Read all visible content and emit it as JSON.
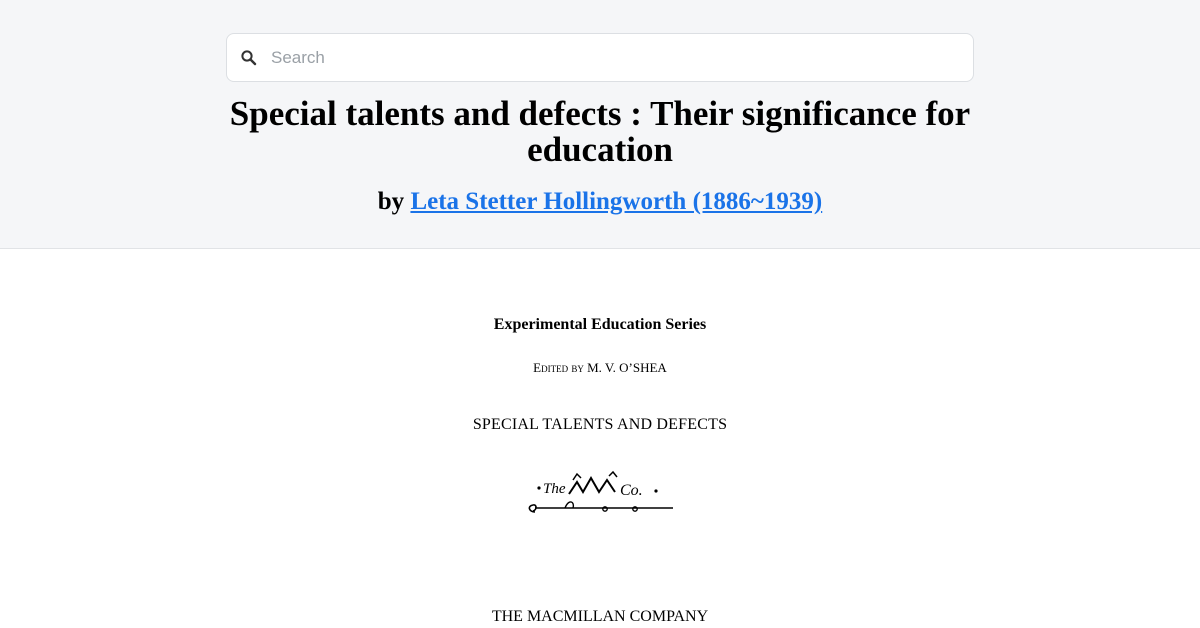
{
  "search": {
    "placeholder": "Search",
    "value": ""
  },
  "book": {
    "title": "Special talents and defects : Their significance for education",
    "by_prefix": "by",
    "author_link": "Leta Stetter Hollingworth (1886~1939)"
  },
  "page": {
    "series_title": "Experimental Education Series",
    "edited_by_label": "Edited by",
    "editor": "M. V. O’SHEA",
    "work_title": "SPECIAL TALENTS AND DEFECTS",
    "publisher_logo_text": "The M Co.",
    "publisher": "THE MACMILLAN COMPANY"
  },
  "colors": {
    "header_bg": "#f5f6f8",
    "link": "#1a73e8",
    "placeholder": "#9aa0a6"
  },
  "icons": {
    "search": "search-icon"
  }
}
